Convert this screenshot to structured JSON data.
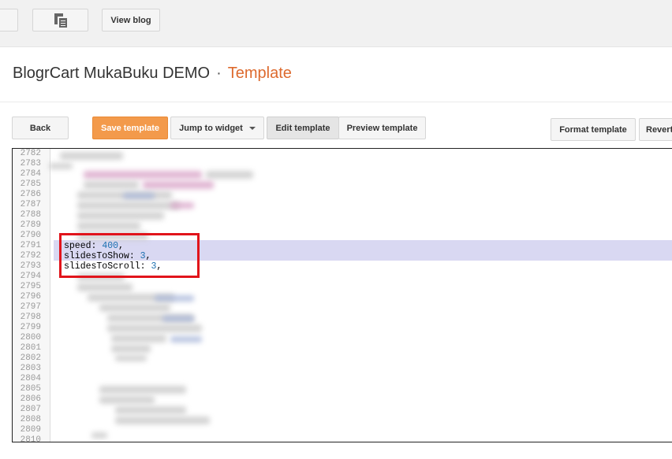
{
  "toolbar": {
    "copy_icon": "copy-pages-icon",
    "view_blog_label": "View blog"
  },
  "header": {
    "blog_title": "BlogrCart MukaBuku DEMO",
    "separator": "·",
    "section": "Template",
    "section_color": "#dd6a2e"
  },
  "actions": {
    "back_label": "Back",
    "save_label": "Save template",
    "save_color": "#f39a4b",
    "jump_label": "Jump to widget",
    "edit_label": "Edit template",
    "preview_label": "Preview template",
    "format_label": "Format template",
    "revert_label": "Revert"
  },
  "editor": {
    "line_numbers": [
      "2782",
      "2783",
      "2784",
      "2785",
      "2786",
      "2787",
      "2788",
      "2789",
      "2790",
      "2791",
      "2792",
      "2793",
      "2794",
      "2795",
      "2796",
      "2797",
      "2798",
      "2799",
      "2800",
      "2801",
      "2802",
      "2803",
      "2804",
      "2805",
      "2806",
      "2807",
      "2808",
      "2809",
      "2810"
    ],
    "visible_lines": [
      {
        "key": "speed",
        "value": "400"
      },
      {
        "key": "slidesToShow",
        "value": "3"
      },
      {
        "key": "slidesToScroll",
        "value": "3"
      }
    ],
    "selection_color": "#d9d8f2",
    "highlight_box_color": "#e1141b"
  }
}
